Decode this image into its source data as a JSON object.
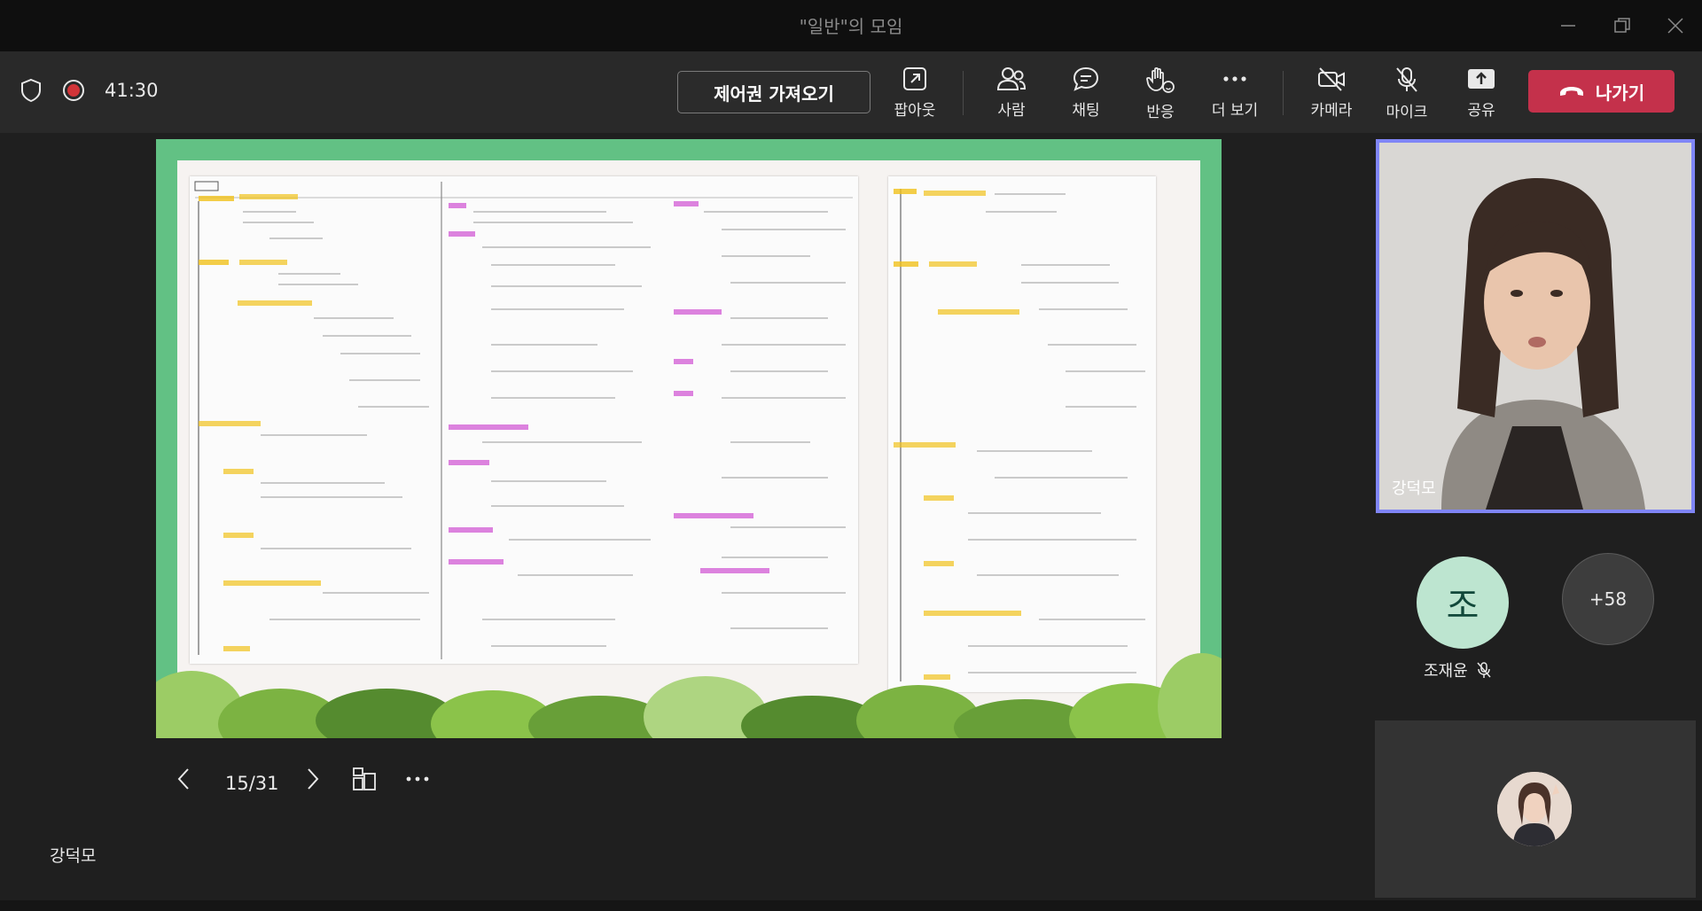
{
  "window": {
    "title": "\"일반\"의 모임"
  },
  "toolbar": {
    "timer": "41:30",
    "take_control": "제어권 가져오기",
    "popout": "팝아웃",
    "people": "사람",
    "chat": "채팅",
    "react": "반응",
    "more": "더 보기",
    "camera": "카메라",
    "mic": "마이크",
    "share": "공유",
    "leave": "나가기"
  },
  "presentation": {
    "page_indicator": "15/31",
    "presenter_name": "강덕모"
  },
  "participants": {
    "featured_name": "강덕모",
    "avatar_initial": "조",
    "avatar_name": "조재윤",
    "more_count": "+58"
  },
  "colors": {
    "leave": "#c4314b",
    "active_border": "#7f85f5",
    "slide_green": "#62c184",
    "avatar_bg": "#bde5d0"
  }
}
